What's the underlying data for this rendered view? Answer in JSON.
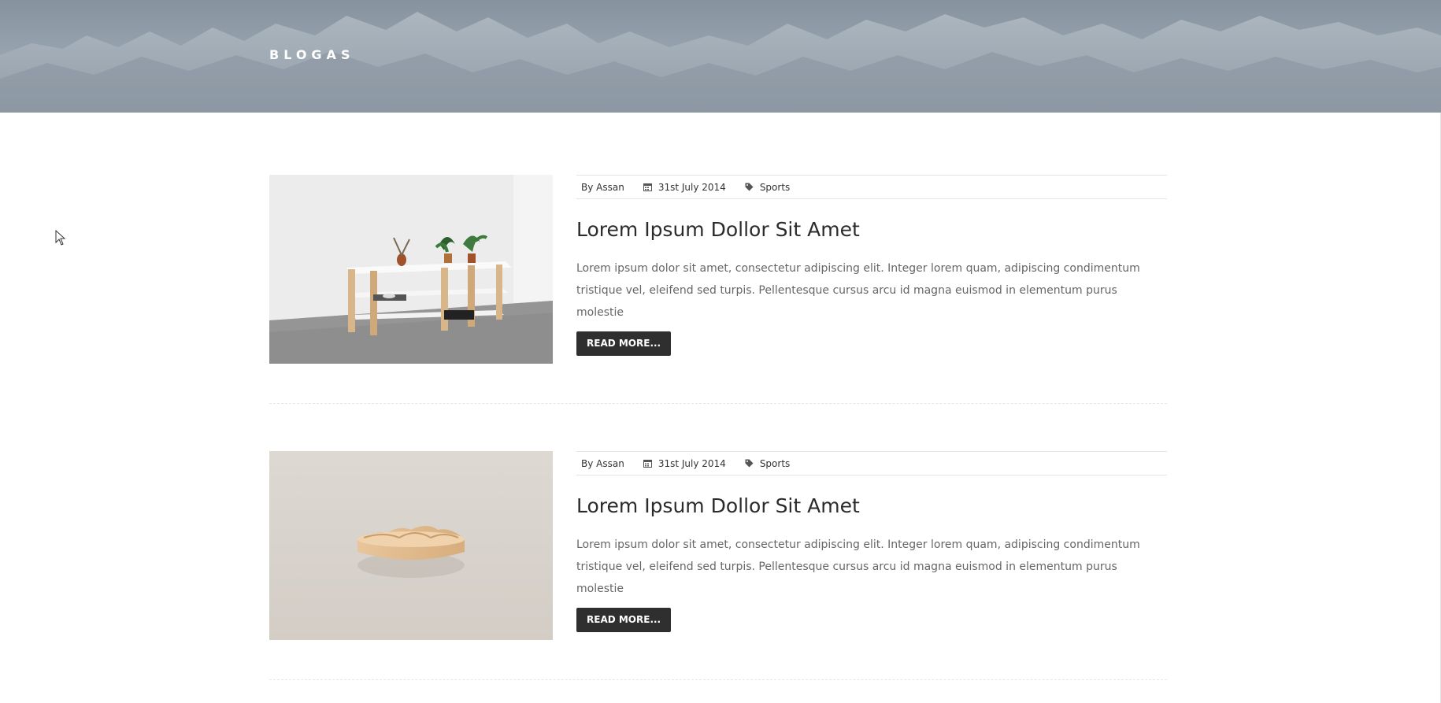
{
  "hero": {
    "title": "BLOGAS"
  },
  "posts": [
    {
      "author": "By Assan",
      "date": "31st July 2014",
      "category": "Sports",
      "title": "Lorem Ipsum Dollor Sit Amet",
      "excerpt": "Lorem ipsum dolor sit amet, consectetur adipiscing elit. Integer lorem quam, adipiscing condimentum tristique vel, eleifend sed turpis. Pellentesque cursus arcu id magna euismod in elementum purus molestie",
      "read_more": "READ MORE...",
      "image": "shelf-with-plants-image"
    },
    {
      "author": "By Assan",
      "date": "31st July 2014",
      "category": "Sports",
      "title": "Lorem Ipsum Dollor Sit Amet",
      "excerpt": "Lorem ipsum dolor sit amet, consectetur adipiscing elit. Integer lorem quam, adipiscing condimentum tristique vel, eleifend sed turpis. Pellentesque cursus arcu id magna euismod in elementum purus molestie",
      "read_more": "READ MORE...",
      "image": "wooden-bowl-image"
    }
  ],
  "icons": {
    "date": "calendar-icon",
    "category": "tag-icon",
    "cursor": "mouse-pointer-icon"
  },
  "colors": {
    "button_bg": "#2f2f2f",
    "title_text": "#2b2b2b",
    "body_text": "#666666"
  }
}
